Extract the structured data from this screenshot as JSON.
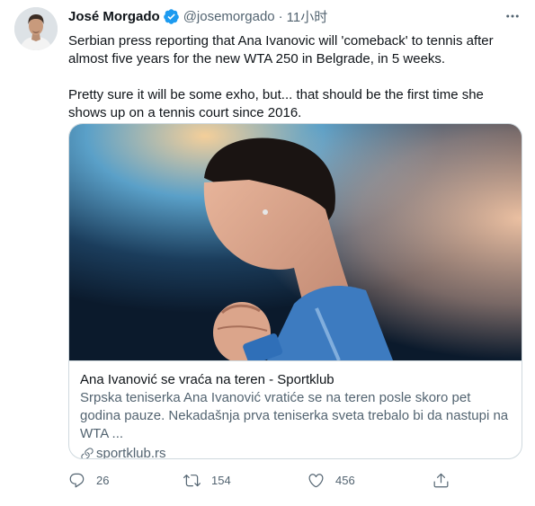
{
  "tweet": {
    "author": {
      "name": "José Morgado",
      "handle": "@josemorgado",
      "verified": true
    },
    "separator": "·",
    "time": "11小时",
    "paragraphs": [
      "Serbian press reporting that Ana Ivanovic will 'comeback' to tennis after almost five years for the new WTA 250 in Belgrade, in 5 weeks.",
      "Pretty sure it will be some exho, but... that should be the first time she shows up on a tennis court since 2016."
    ],
    "card": {
      "title": "Ana Ivanović se vraća na teren - Sportklub",
      "description": "Srpska teniserka Ana Ivanović vratiće se na teren posle skoro pet godina pauze. Nekadašnja prva teniserka sveta trebalo bi da nastupi na WTA ...",
      "domain": "sportklub.rs"
    },
    "actions": {
      "replies": "26",
      "retweets": "154",
      "likes": "456"
    }
  },
  "colors": {
    "text": "#0f1419",
    "secondary": "#536471",
    "verified": "#1d9bf0",
    "border": "#cfd9de"
  },
  "icons": [
    "verified-badge-icon",
    "more-icon",
    "link-icon",
    "reply-icon",
    "retweet-icon",
    "like-icon",
    "share-icon"
  ]
}
